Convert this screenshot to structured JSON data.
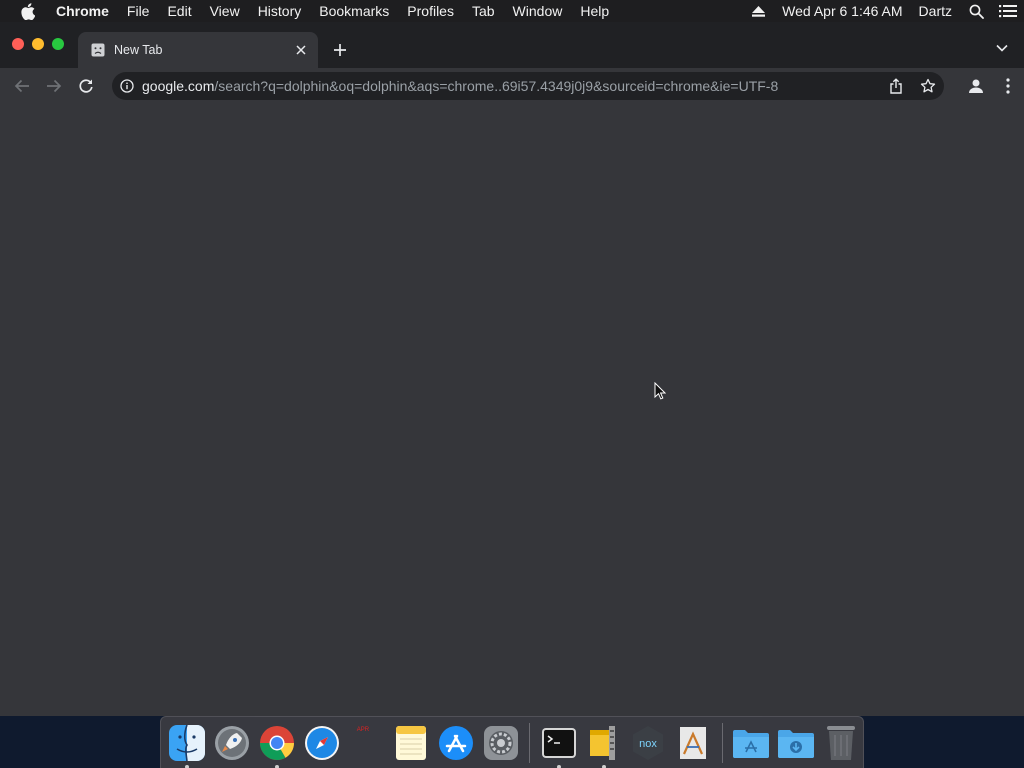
{
  "menubar": {
    "app_name": "Chrome",
    "items": [
      "File",
      "Edit",
      "View",
      "History",
      "Bookmarks",
      "Profiles",
      "Tab",
      "Window",
      "Help"
    ],
    "datetime": "Wed Apr 6  1:46 AM",
    "user": "Dartz"
  },
  "browser": {
    "tab_title": "New Tab",
    "url_host": "google.com",
    "url_path": "/search?q=dolphin&oq=dolphin&aqs=chrome..69i57.4349j0j9&sourceid=chrome&ie=UTF-8"
  },
  "dock": {
    "calendar_month": "APR",
    "items": [
      {
        "name": "Finder",
        "icon": "finder-icon",
        "running": true
      },
      {
        "name": "Launchpad",
        "icon": "launchpad-icon",
        "running": false
      },
      {
        "name": "Google Chrome",
        "icon": "chrome-icon",
        "running": true
      },
      {
        "name": "Safari",
        "icon": "safari-icon",
        "running": false
      },
      {
        "name": "Calendar",
        "icon": "calendar-icon",
        "running": false
      },
      {
        "name": "Notes",
        "icon": "notes-icon",
        "running": false
      },
      {
        "name": "App Store",
        "icon": "app-store-icon",
        "running": false
      },
      {
        "name": "System Preferences",
        "icon": "system-preferences-icon",
        "running": false
      },
      {
        "name": "Terminal",
        "icon": "terminal-icon",
        "running": true
      },
      {
        "name": "Archive Utility",
        "icon": "archive-utility-icon",
        "running": true
      },
      {
        "name": "Nox",
        "icon": "nox-icon",
        "running": false
      },
      {
        "name": "Instruments",
        "icon": "instruments-icon",
        "running": false
      },
      {
        "name": "Applications",
        "icon": "applications-folder-icon",
        "running": false
      },
      {
        "name": "Downloads",
        "icon": "downloads-folder-icon",
        "running": false
      },
      {
        "name": "Trash",
        "icon": "trash-icon",
        "running": false
      }
    ]
  },
  "colors": {
    "menubar_bg": "#1e1e20",
    "tabstrip_bg": "#202124",
    "toolbar_bg": "#35363a",
    "content_bg": "#35363a",
    "desktop_bg": "#0f1a2e"
  }
}
